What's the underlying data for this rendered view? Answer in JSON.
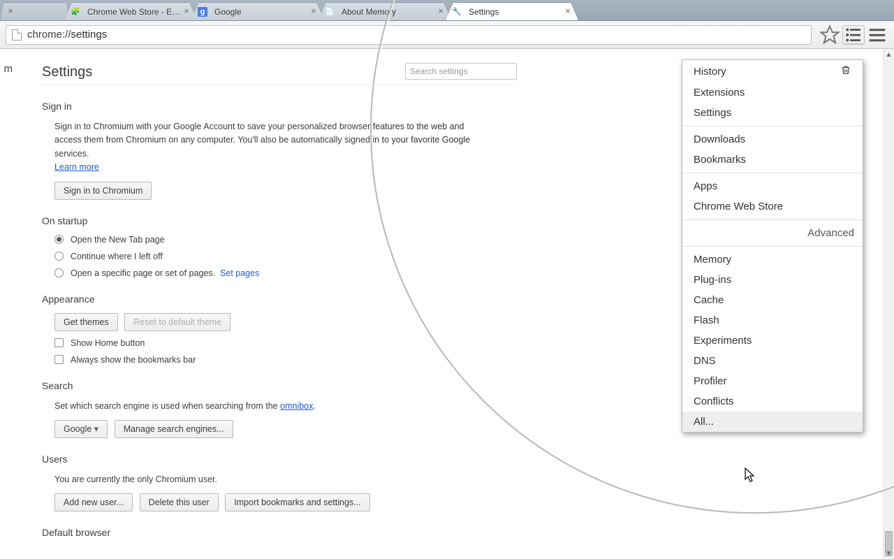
{
  "tabs": [
    {
      "title": "",
      "favicon": ""
    },
    {
      "title": "Chrome Web Store - Exten",
      "favicon": "🧩"
    },
    {
      "title": "Google",
      "favicon": "g"
    },
    {
      "title": "About Memory",
      "favicon": "📄"
    },
    {
      "title": "Settings",
      "favicon": "🔧",
      "active": true
    }
  ],
  "omnibox": {
    "scheme": "chrome://",
    "path": "settings"
  },
  "toolbar_icons": {
    "star": "star-icon",
    "list": "list-icon",
    "menu": "menu-icon"
  },
  "page": {
    "gutter": "m",
    "title": "Settings",
    "search_placeholder": "Search settings",
    "signin": {
      "heading": "Sign in",
      "body": "Sign in to Chromium with your Google Account to save your personalized browser features to the web and access them from Chromium on any computer. You'll also be automatically signed in to your favorite Google services.",
      "learn_more": "Learn more",
      "button": "Sign in to Chromium"
    },
    "startup": {
      "heading": "On startup",
      "opt1": "Open the New Tab page",
      "opt2": "Continue where I left off",
      "opt3": "Open a specific page or set of pages.",
      "set_pages": "Set pages"
    },
    "appearance": {
      "heading": "Appearance",
      "get_themes": "Get themes",
      "reset": "Reset to default theme",
      "show_home": "Show Home button",
      "show_bookmarks": "Always show the bookmarks bar"
    },
    "search": {
      "heading": "Search",
      "body_pre": "Set which search engine is used when searching from the ",
      "omnibox": "omnibox",
      "engine": "Google",
      "manage": "Manage search engines..."
    },
    "users": {
      "heading": "Users",
      "body": "You are currently the only Chromium user.",
      "add": "Add new user...",
      "delete": "Delete this user",
      "import": "Import bookmarks and settings..."
    },
    "default_browser": {
      "heading": "Default browser"
    }
  },
  "menu": {
    "group1": [
      "History",
      "Extensions",
      "Settings"
    ],
    "group2": [
      "Downloads",
      "Bookmarks"
    ],
    "group3": [
      "Apps",
      "Chrome Web Store"
    ],
    "advanced_label": "Advanced",
    "group4": [
      "Memory",
      "Plug-ins",
      "Cache",
      "Flash",
      "Experiments",
      "DNS",
      "Profiler",
      "Conflicts",
      "All..."
    ],
    "hover_index": 8
  }
}
